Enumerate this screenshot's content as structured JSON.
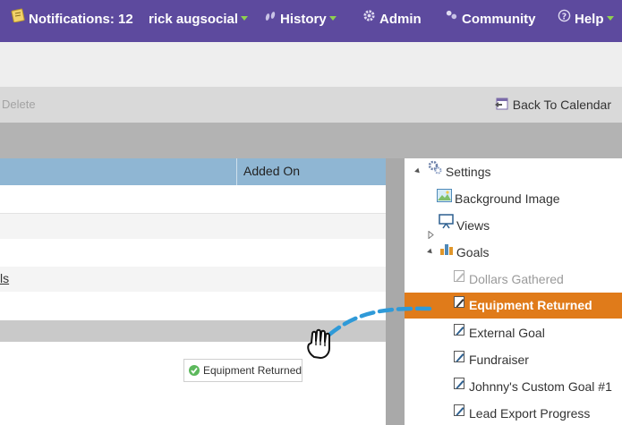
{
  "nav": {
    "notifications": "Notifications: 12",
    "user": "rick augsocial",
    "history": "History",
    "admin": "Admin",
    "community": "Community",
    "help": "Help"
  },
  "toolbar": {
    "delete": "Delete",
    "back_to_calendar": "Back To Calendar"
  },
  "grid": {
    "columns": [
      "Added On"
    ],
    "link_fragment": "ls"
  },
  "drag_chip": {
    "label": "Equipment Returned"
  },
  "tree": {
    "settings": "Settings",
    "background_image": "Background Image",
    "views": "Views",
    "goals": "Goals",
    "goal_items": [
      {
        "label": "Dollars Gathered",
        "state": "disabled"
      },
      {
        "label": "Equipment Returned",
        "state": "selected"
      },
      {
        "label": "External Goal",
        "state": "normal"
      },
      {
        "label": "Fundraiser",
        "state": "normal"
      },
      {
        "label": "Johnny's Custom Goal #1",
        "state": "normal"
      },
      {
        "label": "Lead Export Progress",
        "state": "normal"
      }
    ]
  },
  "colors": {
    "nav_bg": "#5d4a9e",
    "grid_header": "#8fb6d3",
    "selected": "#e07b1a",
    "drag_line": "#2f9ad8"
  },
  "icons": {
    "notifications": "notepad-icon",
    "history": "footsteps-icon",
    "admin": "gear-icon",
    "community": "people-icon",
    "help": "question-icon",
    "back": "calendar-icon",
    "settings": "gears-icon",
    "background": "image-icon",
    "views": "presentation-icon",
    "goals": "bar-chart-icon",
    "goal": "edit-page-icon",
    "chip": "check-circle-icon",
    "cursor": "grab-hand-icon"
  }
}
